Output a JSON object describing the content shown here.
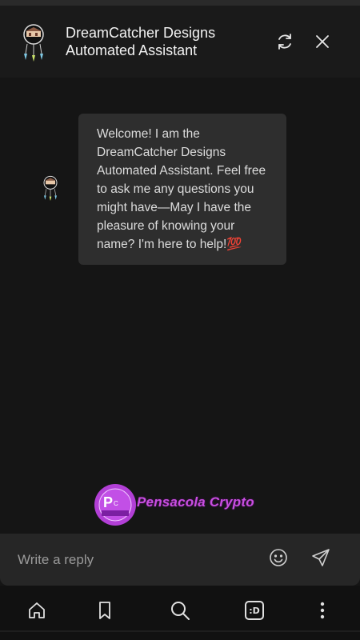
{
  "header": {
    "title_line1": "DreamCatcher Designs",
    "title_line2": "Automated Assistant",
    "avatar_icon": "dreamcatcher-logo-icon",
    "refresh_icon": "refresh-icon",
    "close_icon": "close-icon"
  },
  "chat": {
    "messages": [
      {
        "sender": "bot",
        "text": "Welcome! I am the DreamCatcher Designs Automated Assistant. Feel free to ask me any questions you might have—May I have the pleasure of knowing your name? I'm here to help!💯"
      }
    ]
  },
  "branding": {
    "logo_text": "Pensacola Crypto",
    "brand_color": "#c84ee0"
  },
  "composer": {
    "placeholder": "Write a reply",
    "value": "",
    "emoji_icon": "smiley-icon",
    "send_icon": "send-icon"
  },
  "navbar": {
    "items": [
      {
        "icon": "home-icon"
      },
      {
        "icon": "bookmark-icon"
      },
      {
        "icon": "search-icon"
      },
      {
        "icon": "tabs-icon",
        "label": ":D"
      },
      {
        "icon": "more-vertical-icon"
      }
    ]
  },
  "colors": {
    "background": "#151515",
    "bubble": "#2e2e2e",
    "composer": "#262626",
    "text": "#e8e8e8"
  }
}
